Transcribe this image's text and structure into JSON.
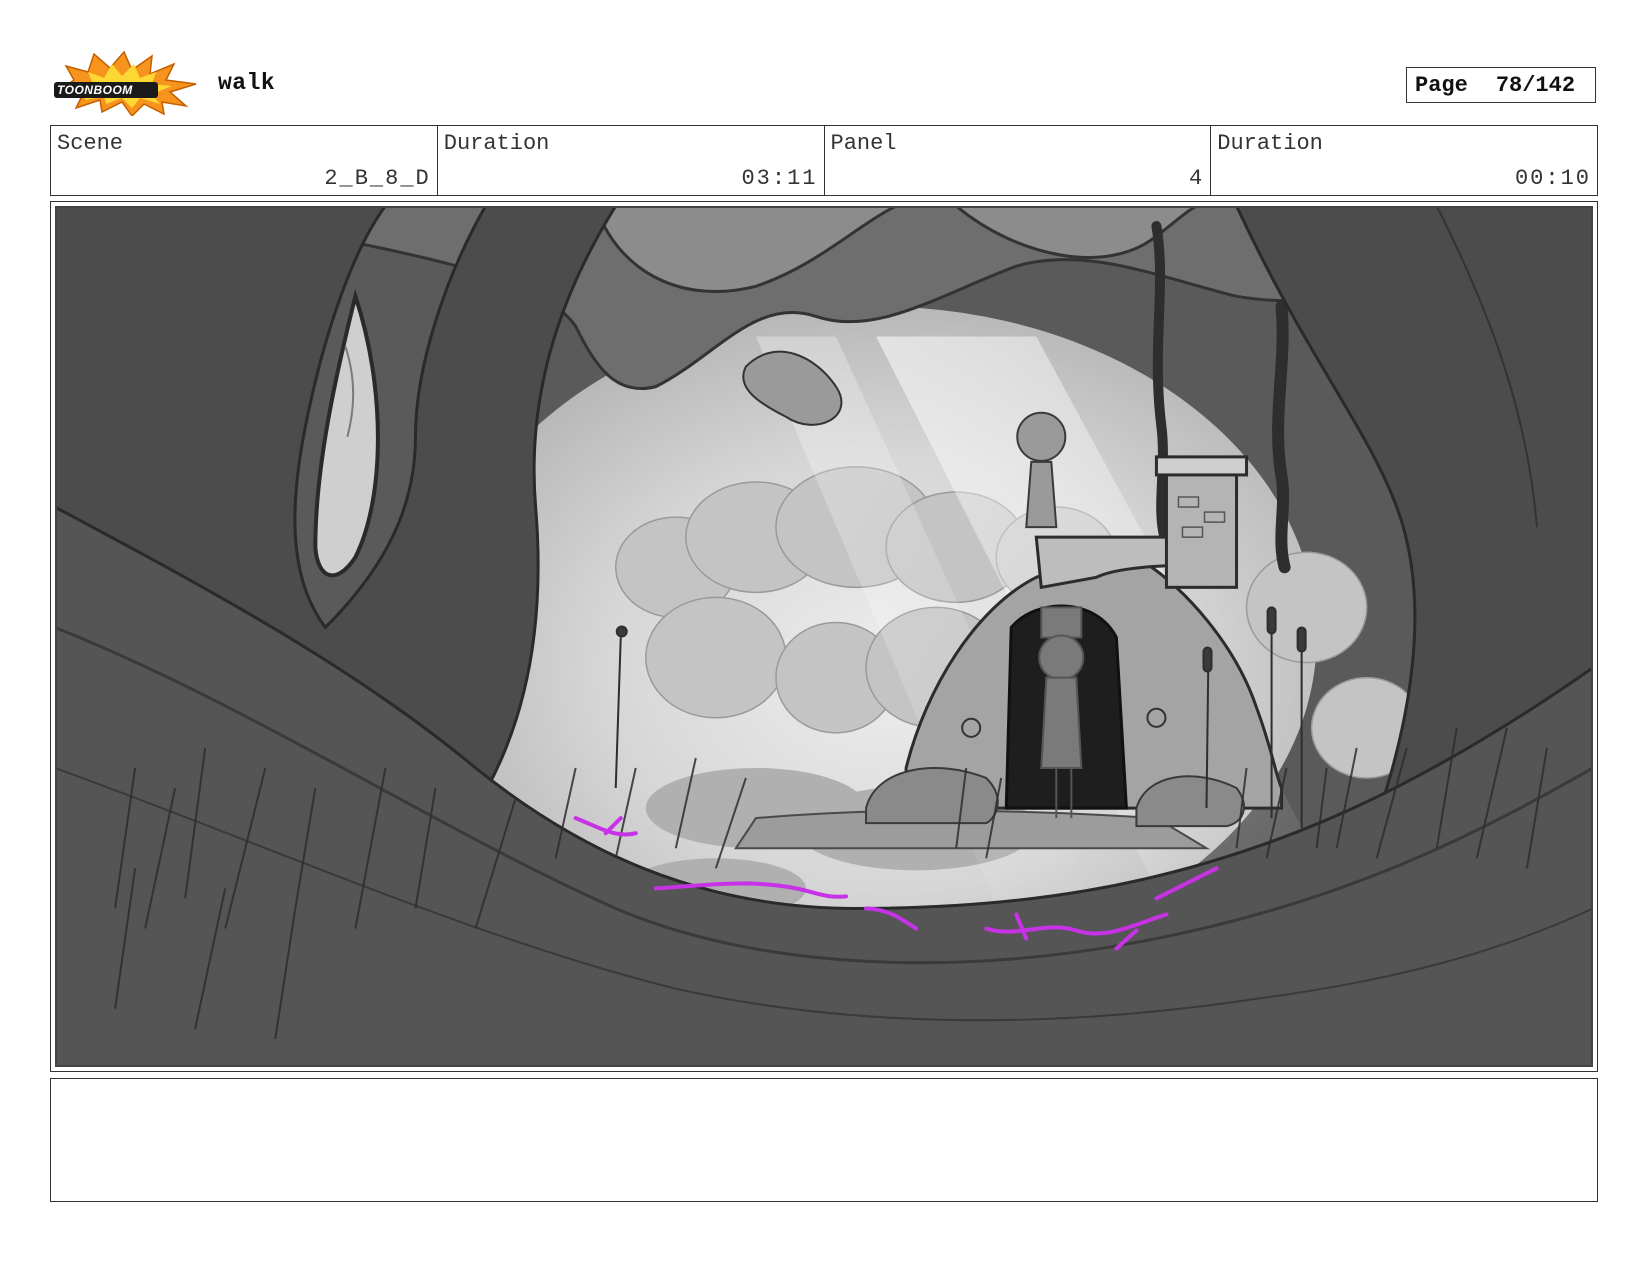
{
  "header": {
    "logo_text": "TOONBOOM",
    "title": "walk",
    "page_label": "Page",
    "page_number": "78/142"
  },
  "info": {
    "scene_label": "Scene",
    "scene_value": "2_B_8_D",
    "scene_duration_label": "Duration",
    "scene_duration_value": "03:11",
    "panel_label": "Panel",
    "panel_value": "4",
    "panel_duration_label": "Duration",
    "panel_duration_value": "00:10"
  },
  "notes": {
    "text": ""
  },
  "colors": {
    "logo_orange": "#f7941d",
    "logo_yellow": "#fdd835",
    "glow_magenta": "#c832e6",
    "dark_foliage": "#555555"
  }
}
